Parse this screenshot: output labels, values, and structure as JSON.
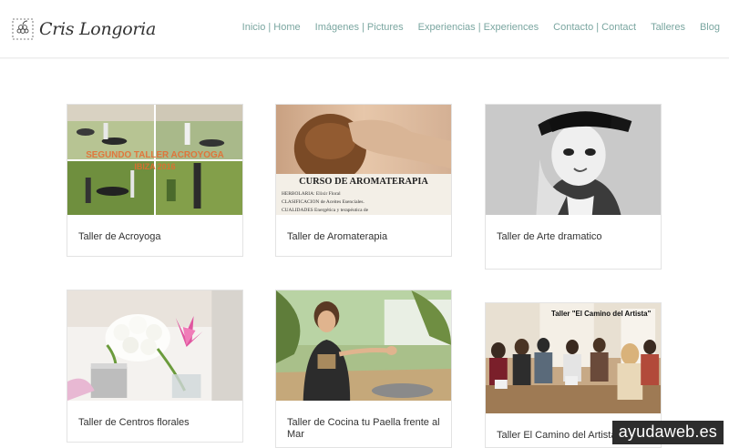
{
  "header": {
    "logo_text": "Cris Longoria",
    "nav": [
      {
        "label": "Inicio | Home"
      },
      {
        "label": "Imágenes | Pictures"
      },
      {
        "label": "Experiencias | Experiences"
      },
      {
        "label": "Contacto | Contact"
      },
      {
        "label": "Talleres"
      },
      {
        "label": "Blog"
      }
    ]
  },
  "cards": [
    {
      "title": "Taller de Acroyoga",
      "image_caption": "SEGUNDO TALLER ACROYOGA IBIZA 2016"
    },
    {
      "title": "Taller de Aromaterapia",
      "image_heading": "CURSO DE AROMATERAPIA",
      "image_lines": [
        "HERBOLARIA: Elixir Floral",
        "CLASIFICACION de Aceites Esenciales.",
        "CUALIDADES Energética y terapéutica de"
      ]
    },
    {
      "title": "Taller de Arte dramatico"
    },
    {
      "title": "Taller de Centros florales"
    },
    {
      "title": "Taller de Cocina tu Paella frente al Mar"
    },
    {
      "title": "Taller El Camino del Artista",
      "image_caption": "Taller \"El Camino del Artista\""
    }
  ],
  "watermark": "ayudaweb.es"
}
